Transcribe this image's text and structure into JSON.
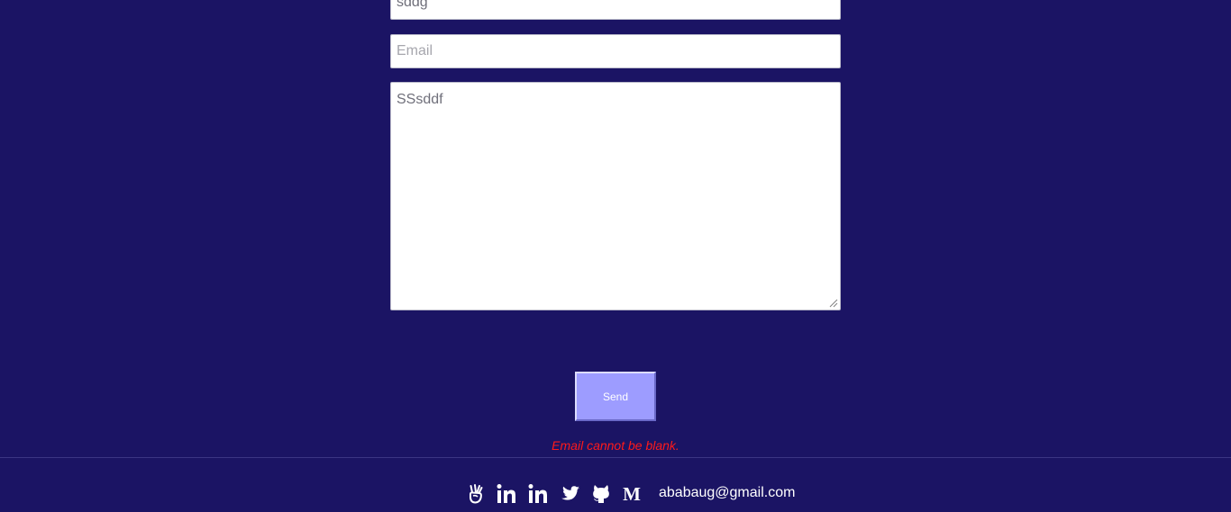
{
  "form": {
    "name_value": "sddg",
    "email_value": "",
    "email_placeholder": "Email",
    "message_value": "SSsddf",
    "send_label": "Send",
    "error_message": "Email cannot be blank."
  },
  "footer": {
    "icons": [
      "angellist-icon",
      "linkedin-icon",
      "linkedin-icon",
      "twitter-icon",
      "github-icon",
      "medium-icon"
    ],
    "medium_glyph": "M",
    "email": "ababaug@gmail.com"
  },
  "colors": {
    "background": "#1b1464",
    "button": "#9d9cff",
    "error": "#ff1a1a"
  }
}
